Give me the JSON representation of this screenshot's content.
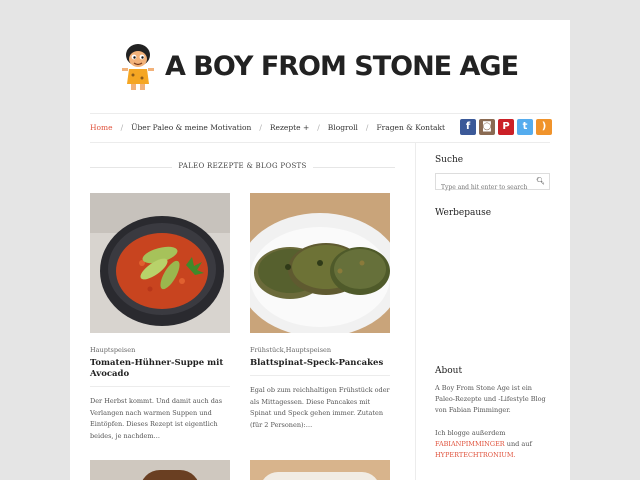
{
  "site": {
    "title": "A BOY FROM STONE AGE"
  },
  "nav": {
    "items": [
      {
        "label": "Home",
        "active": true
      },
      {
        "label": "Über Paleo & meine Motivation"
      },
      {
        "label": "Rezepte +"
      },
      {
        "label": "Blogroll"
      },
      {
        "label": "Fragen & Kontakt"
      }
    ],
    "separator": "/"
  },
  "social": [
    {
      "name": "facebook-icon",
      "glyph": "f",
      "color": "#3b5998"
    },
    {
      "name": "instagram-icon",
      "glyph": "◙",
      "color": "#8a6a52"
    },
    {
      "name": "pinterest-icon",
      "glyph": "P",
      "color": "#cb2027"
    },
    {
      "name": "twitter-icon",
      "glyph": "t",
      "color": "#55acee"
    },
    {
      "name": "rss-icon",
      "glyph": ")",
      "color": "#f0932b"
    }
  ],
  "section": {
    "heading": "PALEO REZEPTE & BLOG POSTS"
  },
  "posts": [
    {
      "category": "Hauptspeisen",
      "title": "Tomaten-Hühner-Suppe mit Avocado",
      "excerpt": "Der Herbst kommt. Und damit auch das Verlangen nach warmen Suppen und Eintöpfen. Dieses Rezept ist eigentlich beides, je nachdem…"
    },
    {
      "category": "Frühstück,Hauptspeisen",
      "title": "Blattspinat-Speck-Pancakes",
      "excerpt": "Egal ob zum reichhaltigen Frühstück oder als Mittagessen. Diese Pancakes mit Spinat und Speck gehen immer. Zutaten (für 2 Personen):…"
    }
  ],
  "sidebar": {
    "search_title": "Suche",
    "search_placeholder": "Type and hit enter to search",
    "ads_title": "Werbepause",
    "about_title": "About",
    "about_text": "A Boy From Stone Age ist ein Paleo-Rezepte und -Lifestyle Blog von Fabian Pimminger.",
    "blog_prefix": "Ich blogge außerdem",
    "link1": "FABIANPIMMINGER",
    "blog_mid": "und auf",
    "link2": "HYPERTECHTRONIUM."
  },
  "colors": {
    "accent": "#e0533d",
    "background": "#e5e5e5"
  }
}
